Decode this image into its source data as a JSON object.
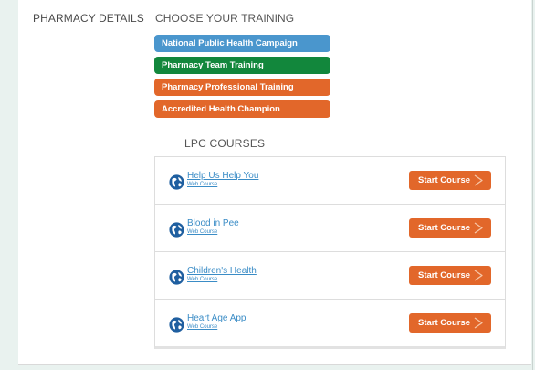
{
  "left_label": "PHARMACY DETAILS",
  "training_heading": "CHOOSE YOUR TRAINING",
  "trainings": [
    {
      "label": "National Public Health Campaign",
      "color": "#4a96cd"
    },
    {
      "label": "Pharmacy Team Training",
      "color": "#12873c"
    },
    {
      "label": "Pharmacy Professional Training",
      "color": "#e2672a"
    },
    {
      "label": "Accredited Health Champion",
      "color": "#e2672a"
    }
  ],
  "lpc_heading": "LPC COURSES",
  "courses": [
    {
      "title": "Help Us Help You",
      "type": "Web Course",
      "button_label": "Start Course"
    },
    {
      "title": "Blood in Pee",
      "type": "Web Course",
      "button_label": "Start Course"
    },
    {
      "title": "Children's Health",
      "type": "Web Course",
      "button_label": "Start Course"
    },
    {
      "title": "Heart Age App",
      "type": "Web Course",
      "button_label": "Start Course"
    }
  ],
  "colors": {
    "link": "#3a8cc6",
    "accent": "#e2672a",
    "globe": "#1f5fa0"
  },
  "icons": {
    "course_icon": "globe-icon",
    "button_icon": "chevron-right-icon"
  }
}
